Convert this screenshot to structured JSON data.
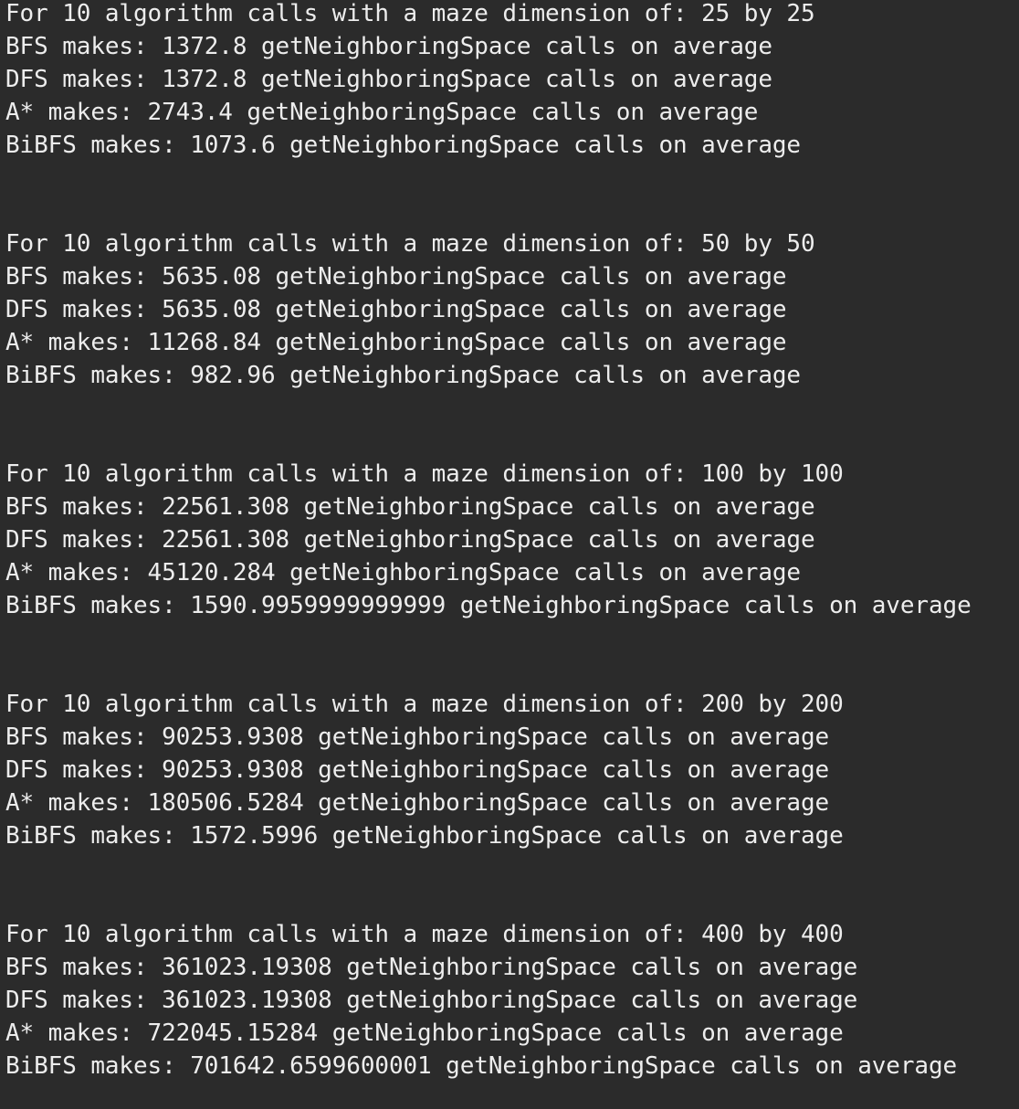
{
  "terminal": {
    "blocks": [
      {
        "header": "For 10 algorithm calls with a maze dimension of: 25 by 25",
        "lines": [
          "BFS makes: 1372.8 getNeighboringSpace calls on average",
          "DFS makes: 1372.8 getNeighboringSpace calls on average",
          "A* makes: 2743.4 getNeighboringSpace calls on average",
          "BiBFS makes: 1073.6 getNeighboringSpace calls on average"
        ]
      },
      {
        "header": "For 10 algorithm calls with a maze dimension of: 50 by 50",
        "lines": [
          "BFS makes: 5635.08 getNeighboringSpace calls on average",
          "DFS makes: 5635.08 getNeighboringSpace calls on average",
          "A* makes: 11268.84 getNeighboringSpace calls on average",
          "BiBFS makes: 982.96 getNeighboringSpace calls on average"
        ]
      },
      {
        "header": "For 10 algorithm calls with a maze dimension of: 100 by 100",
        "lines": [
          "BFS makes: 22561.308 getNeighboringSpace calls on average",
          "DFS makes: 22561.308 getNeighboringSpace calls on average",
          "A* makes: 45120.284 getNeighboringSpace calls on average",
          "BiBFS makes: 1590.9959999999999 getNeighboringSpace calls on average"
        ]
      },
      {
        "header": "For 10 algorithm calls with a maze dimension of: 200 by 200",
        "lines": [
          "BFS makes: 90253.9308 getNeighboringSpace calls on average",
          "DFS makes: 90253.9308 getNeighboringSpace calls on average",
          "A* makes: 180506.5284 getNeighboringSpace calls on average",
          "BiBFS makes: 1572.5996 getNeighboringSpace calls on average"
        ]
      },
      {
        "header": "For 10 algorithm calls with a maze dimension of: 400 by 400",
        "lines": [
          "BFS makes: 361023.19308 getNeighboringSpace calls on average",
          "DFS makes: 361023.19308 getNeighboringSpace calls on average",
          "A* makes: 722045.15284 getNeighboringSpace calls on average",
          "BiBFS makes: 701642.6599600001 getNeighboringSpace calls on average"
        ]
      }
    ]
  }
}
